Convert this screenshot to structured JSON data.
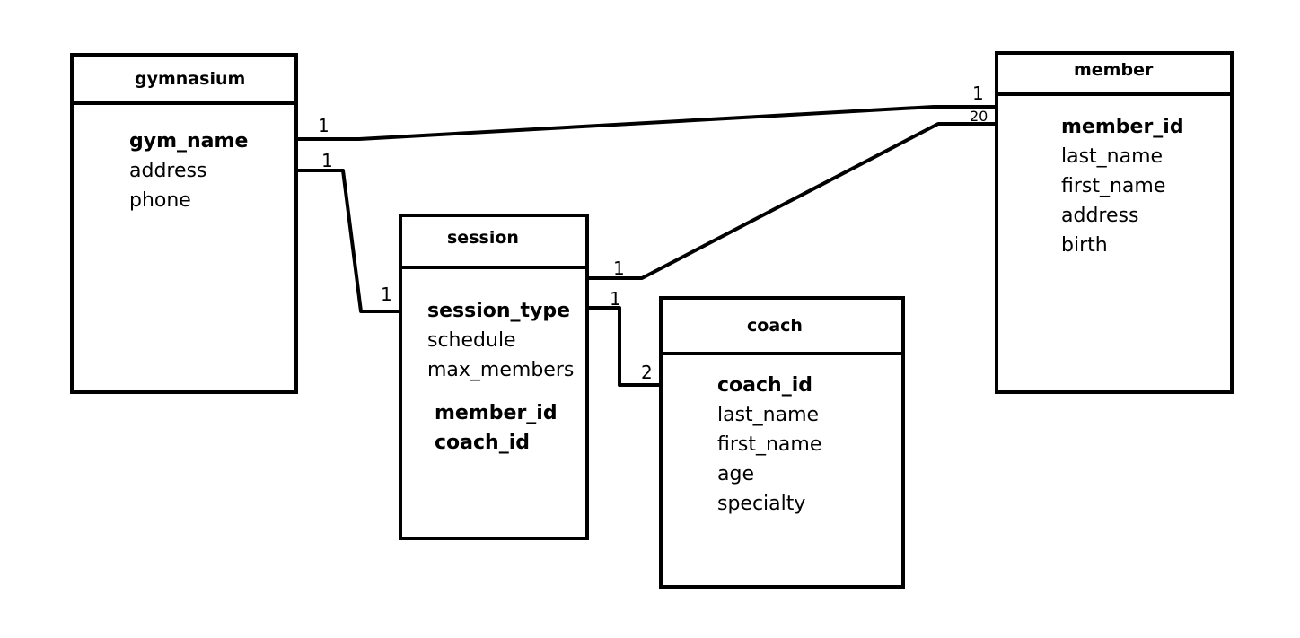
{
  "entities": {
    "gymnasium": {
      "title": "gymnasium",
      "attributes": [
        {
          "name": "gym_name",
          "key": true
        },
        {
          "name": "address",
          "key": false
        },
        {
          "name": "phone",
          "key": false
        }
      ]
    },
    "member": {
      "title": "member",
      "attributes": [
        {
          "name": "member_id",
          "key": true
        },
        {
          "name": "last_name",
          "key": false
        },
        {
          "name": "first_name",
          "key": false
        },
        {
          "name": "address",
          "key": false
        },
        {
          "name": "birth",
          "key": false
        }
      ]
    },
    "session": {
      "title": "session",
      "attributes": [
        {
          "name": "session_type",
          "key": true
        },
        {
          "name": "schedule",
          "key": false
        },
        {
          "name": "max_members",
          "key": false
        }
      ],
      "foreign_keys": [
        {
          "name": "member_id",
          "key": true
        },
        {
          "name": "coach_id",
          "key": true
        }
      ]
    },
    "coach": {
      "title": "coach",
      "attributes": [
        {
          "name": "coach_id",
          "key": true
        },
        {
          "name": "last_name",
          "key": false
        },
        {
          "name": "first_name",
          "key": false
        },
        {
          "name": "age",
          "key": false
        },
        {
          "name": "specialty",
          "key": false
        }
      ]
    }
  },
  "relationships": [
    {
      "from": "gymnasium",
      "to": "member",
      "from_card": "1",
      "to_card": "1"
    },
    {
      "from": "gymnasium",
      "to": "session",
      "from_card": "1",
      "to_card": "1"
    },
    {
      "from": "session",
      "to": "member",
      "from_card": "1",
      "to_card": "20"
    },
    {
      "from": "session",
      "to": "coach",
      "from_card": "1",
      "to_card": "2"
    }
  ]
}
